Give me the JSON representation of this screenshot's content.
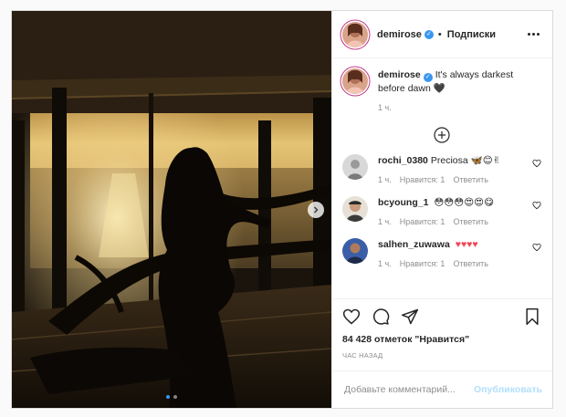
{
  "post": {
    "author": "demirose",
    "header_separator": "•",
    "follow_label": "Подписки",
    "caption": {
      "username": "demirose",
      "text": "It's always darkest before dawn",
      "emoji": "🖤",
      "time": "1 ч."
    },
    "load_more_icon": "plus-circle-icon",
    "comments": [
      {
        "username": "rochi_0380",
        "text": "Preciosa",
        "emojis": "🦋😊✌",
        "time": "1 ч.",
        "likes": "Нравится: 1",
        "reply": "Ответить"
      },
      {
        "username": "bcyoung_1",
        "text": "",
        "emojis": "😳😳😳😍😍😋",
        "time": "1 ч.",
        "likes": "Нравится: 1",
        "reply": "Ответить"
      },
      {
        "username": "salhen_zuwawa",
        "text": "",
        "emojis": "♥♥♥♥",
        "time": "1 ч.",
        "likes": "Нравится: 1",
        "reply": "Ответить"
      }
    ],
    "likes_text": "84 428 отметок \"Нравится\"",
    "timestamp": "ЧАС НАЗАД",
    "add_comment_placeholder": "Добавьте комментарий...",
    "publish_label": "Опубликовать",
    "carousel": {
      "total": 2,
      "active": 1
    }
  },
  "colors": {
    "accent": "#3897f0",
    "verified": "#3897f0",
    "heart_red": "#ed4956",
    "muted_text": "#8e8e8e",
    "publish_disabled": "#b2dffc"
  }
}
